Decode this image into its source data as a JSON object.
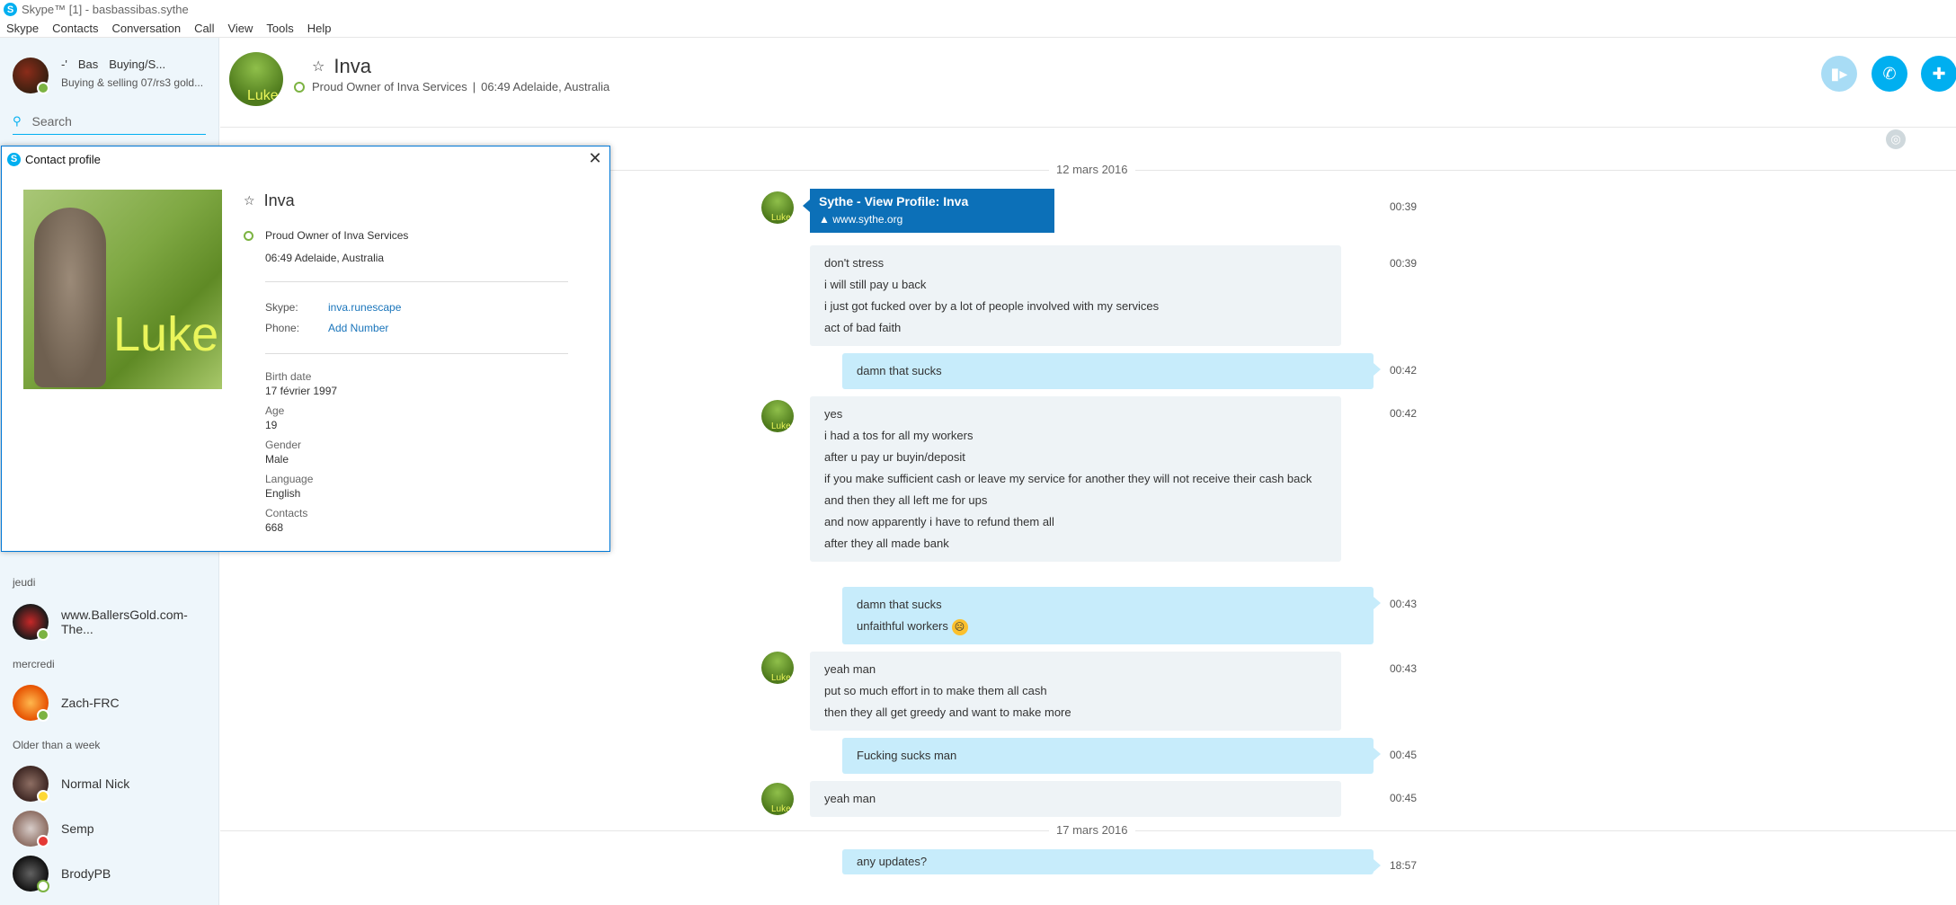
{
  "window": {
    "title": "Skype™ [1] - basbassibas.sythe"
  },
  "menu": [
    "Skype",
    "Contacts",
    "Conversation",
    "Call",
    "View",
    "Tools",
    "Help"
  ],
  "me": {
    "name_a": "-'",
    "name_b": "Bas",
    "name_c": "Buying/S...",
    "mood": "Buying & selling 07/rs3 gold..."
  },
  "search": {
    "placeholder": "Search"
  },
  "sidebar": {
    "sections": [
      "jeudi",
      "mercredi",
      "Older than a week"
    ],
    "contacts": [
      {
        "name": "www.BallersGold.com-The...",
        "status": "online"
      },
      {
        "name": "Zach-FRC",
        "status": "online"
      },
      {
        "name": "Normal Nick",
        "status": "away"
      },
      {
        "name": "Semp",
        "status": "dnd"
      },
      {
        "name": "BrodyPB",
        "status": "offline"
      }
    ]
  },
  "conversation": {
    "name": "Inva",
    "mood": "Proud Owner of Inva Services",
    "local_time": "06:49 Adelaide, Australia",
    "separator": "|"
  },
  "dates": [
    "12 mars 2016",
    "17 mars 2016"
  ],
  "messages": {
    "link": {
      "title": "Sythe - View Profile: Inva",
      "url": "www.sythe.org",
      "time": "00:39"
    },
    "m1": {
      "lines": [
        "don't stress",
        "i will still pay u back",
        "i just got fucked over by a lot of people involved with my services",
        "act of bad faith"
      ],
      "time": "00:39"
    },
    "m2": {
      "lines": [
        "damn that sucks"
      ],
      "time": "00:42"
    },
    "m3": {
      "lines": [
        "yes",
        "i had a tos for all my workers",
        "after u pay ur buyin/deposit",
        "if you make sufficient cash or leave my service for another they will not receive their cash back",
        "and then they all left me for ups",
        "and now apparently i have to refund them all",
        "after they all made bank"
      ],
      "time": "00:42"
    },
    "m4": {
      "lines": [
        "damn that sucks",
        "unfaithful workers"
      ],
      "time": "00:43"
    },
    "m5": {
      "lines": [
        "yeah man",
        "put so much effort in to make them all cash",
        "then they all get greedy and want to make more"
      ],
      "time": "00:43"
    },
    "m6": {
      "lines": [
        "Fucking sucks man"
      ],
      "time": "00:45"
    },
    "m7": {
      "lines": [
        "yeah man"
      ],
      "time": "00:45"
    },
    "m8": {
      "lines": [
        "any updates?"
      ],
      "time": "18:57"
    }
  },
  "dialog": {
    "title": "Contact profile",
    "name": "Inva",
    "photo_text": "Luke",
    "mood": "Proud Owner of Inva Services",
    "location": "06:49 Adelaide, Australia",
    "skype_label": "Skype:",
    "skype_value": "inva.runescape",
    "phone_label": "Phone:",
    "phone_value": "Add Number",
    "fields": [
      {
        "k": "Birth date",
        "v": "17 février 1997"
      },
      {
        "k": "Age",
        "v": "19"
      },
      {
        "k": "Gender",
        "v": "Male"
      },
      {
        "k": "Language",
        "v": "English"
      },
      {
        "k": "Contacts",
        "v": "668"
      }
    ]
  },
  "colors": {
    "accent": "#00aff0",
    "link_card": "#0c70b8",
    "outgoing": "#c7ecfb",
    "incoming": "#eef3f6",
    "online": "#7cb342"
  }
}
